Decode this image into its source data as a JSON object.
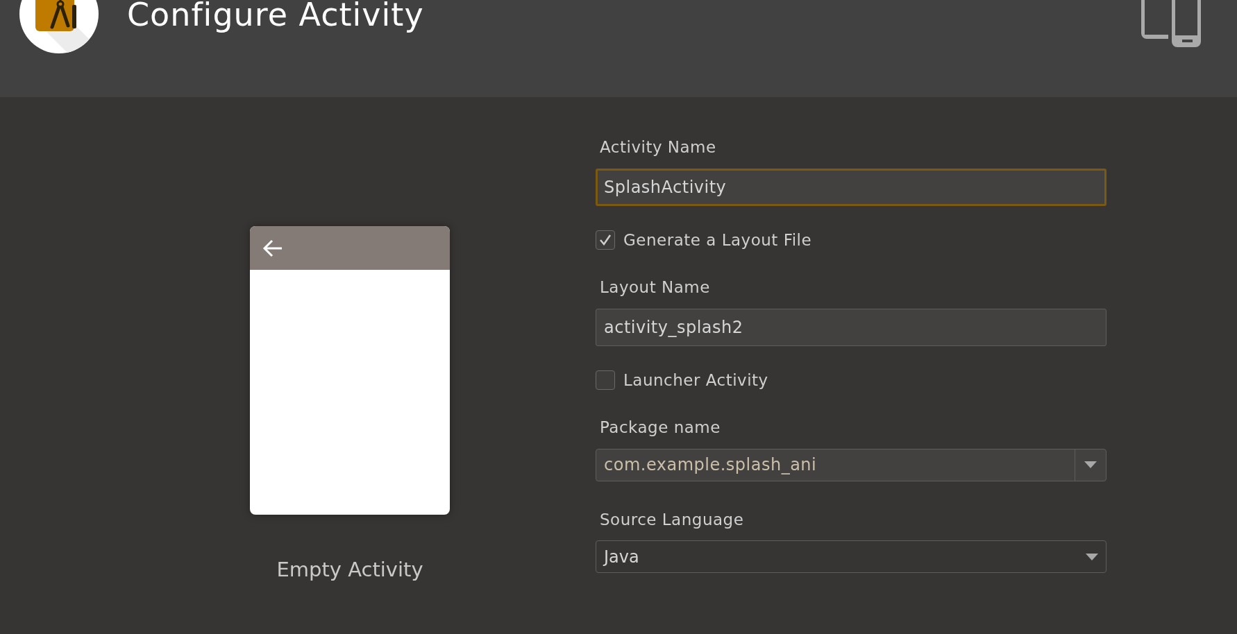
{
  "header": {
    "title": "Configure Activity"
  },
  "preview": {
    "caption": "Empty Activity"
  },
  "form": [
    {
      "kind": "text",
      "label": "Activity Name",
      "value": "SplashActivity",
      "focused": true
    },
    {
      "kind": "checkbox",
      "label": "Generate a Layout File",
      "checked": true
    },
    {
      "kind": "text",
      "label": "Layout Name",
      "value": "activity_splash2",
      "focused": false
    },
    {
      "kind": "checkbox",
      "label": "Launcher Activity",
      "checked": false
    },
    {
      "kind": "combo",
      "label": "Package name",
      "value": "com.example.splash_ani"
    },
    {
      "kind": "select",
      "label": "Source Language",
      "value": "Java"
    }
  ]
}
